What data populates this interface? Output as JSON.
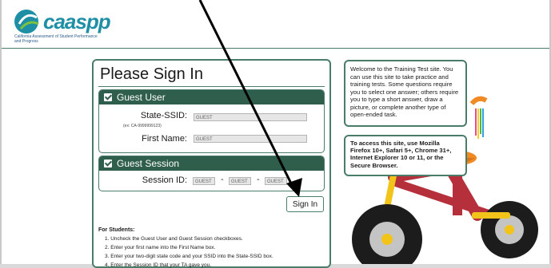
{
  "header": {
    "logo_word": "caaspp",
    "logo_sub": "California Assessment of Student Performance and Progress"
  },
  "signin": {
    "title": "Please Sign In",
    "guest_user": {
      "header": "Guest User",
      "ssid_label": "State-SSID:",
      "ssid_hint": "(ex: CA-9999999123)",
      "ssid_value": "GUEST",
      "firstname_label": "First Name:",
      "firstname_value": "GUEST"
    },
    "guest_session": {
      "header": "Guest Session",
      "session_label": "Session ID:",
      "part1": "GUEST",
      "part2": "GUEST",
      "part3": "GUEST",
      "dash": "-"
    },
    "button_label": "Sign In",
    "instructions": {
      "title": "For Students:",
      "steps": [
        "1.  Uncheck the Guest User and Guest Session checkboxes.",
        "2.  Enter your first name into the First Name box.",
        "3.  Enter your two-digit state code and your SSID into the State-SSID box.",
        "4.  Enter the Session ID that your TA gave you."
      ]
    }
  },
  "callouts": {
    "welcome": "Welcome to the Training Test site. You can use this site to take practice and training tests. Some questions require you to select one answer; others require you to type a short answer, draw a picture, or complete another type of open-ended task.",
    "browsers": "To access this site, use Mozilla Firefox 10+, Safari 5+, Chrome 31+, Internet Explorer 10 or 11, or the Secure Browser."
  },
  "colors": {
    "accent": "#2f5f4c",
    "border": "#4a7c6a",
    "logo": "#1f8fa6"
  }
}
